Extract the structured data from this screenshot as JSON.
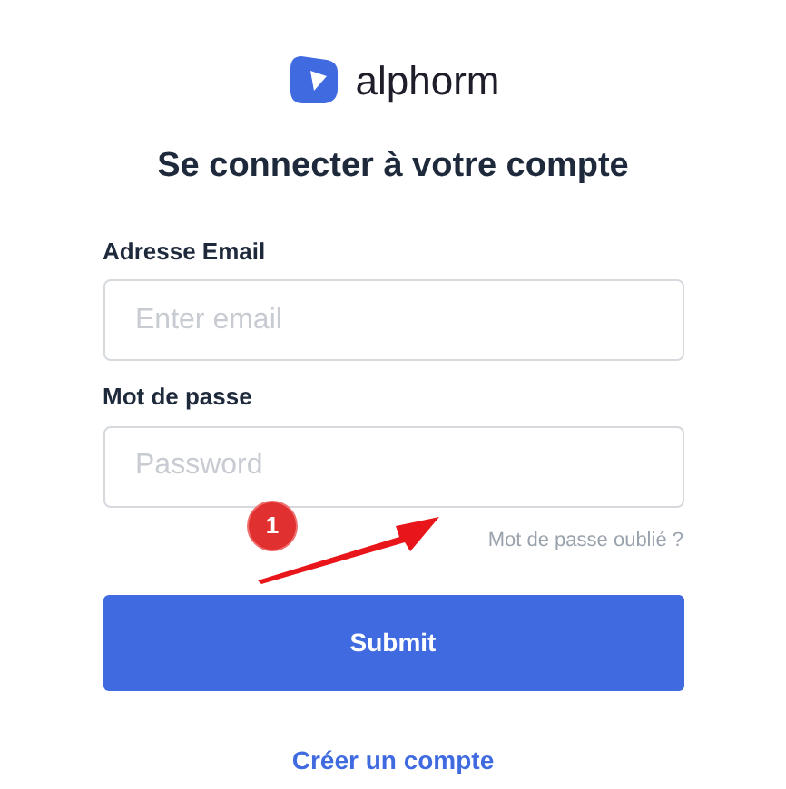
{
  "logo": {
    "text": "alphorm"
  },
  "title": "Se connecter à votre compte",
  "fields": [
    {
      "label": "Adresse Email",
      "placeholder": "Enter email"
    },
    {
      "label": "Mot de passe",
      "placeholder": "Password"
    }
  ],
  "forgot_link": "Mot de passe oublié ?",
  "annotation": {
    "badge": "1"
  },
  "submit_button": "Submit",
  "create_account_link": "Créer un compte"
}
